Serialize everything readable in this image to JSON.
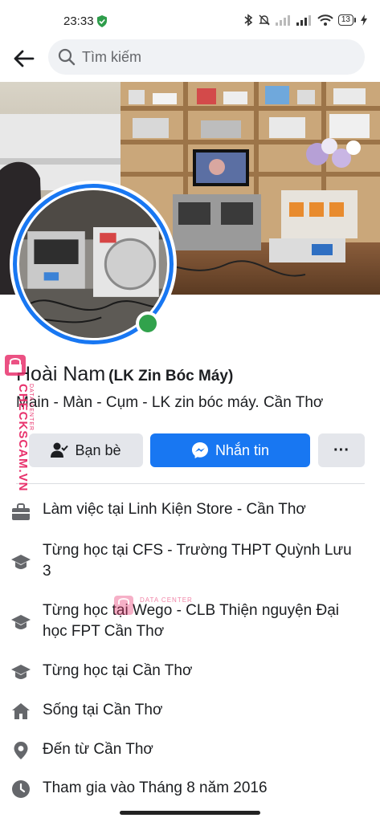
{
  "status": {
    "time": "23:33",
    "battery": "13"
  },
  "search": {
    "placeholder": "Tìm kiếm"
  },
  "profile": {
    "name": "Hoài Nam",
    "alternate_name": "(LK Zin Bóc Máy)",
    "bio": "Main - Màn - Cụm - LK zin bóc máy. Cần Thơ"
  },
  "actions": {
    "friends_label": "Bạn bè",
    "message_label": "Nhắn tin",
    "more_label": "···"
  },
  "details": [
    {
      "icon": "briefcase-icon",
      "prefix": "Làm việc tại ",
      "value": "Linh Kiện Store - Cần Thơ"
    },
    {
      "icon": "graduation-cap-icon",
      "prefix": "Từng học tại ",
      "value": "CFS - Trường THPT Quỳnh Lưu 3"
    },
    {
      "icon": "graduation-cap-icon",
      "prefix": "Từng học tại ",
      "value": "Wego - CLB Thiện nguyện Đại học FPT Cần Thơ"
    },
    {
      "icon": "graduation-cap-icon",
      "prefix": "Từng học tại ",
      "value": "Cần Thơ"
    },
    {
      "icon": "home-icon",
      "prefix": "Sống tại ",
      "value": "Cần Thơ"
    },
    {
      "icon": "location-pin-icon",
      "prefix": "Đến từ ",
      "value": "Cần Thơ"
    },
    {
      "icon": "clock-icon",
      "prefix": "Tham gia vào ",
      "value": "Tháng 8 năm 2016"
    }
  ],
  "watermark": {
    "vertical_text": "CHECKSCAM.VN",
    "vertical_subtext": "DATA CENTER",
    "center_text": "DATA CENTER"
  },
  "colors": {
    "accent": "#1877f2",
    "online": "#31a24c",
    "secondary_button": "#e4e6eb",
    "watermark": "#e8336d"
  }
}
